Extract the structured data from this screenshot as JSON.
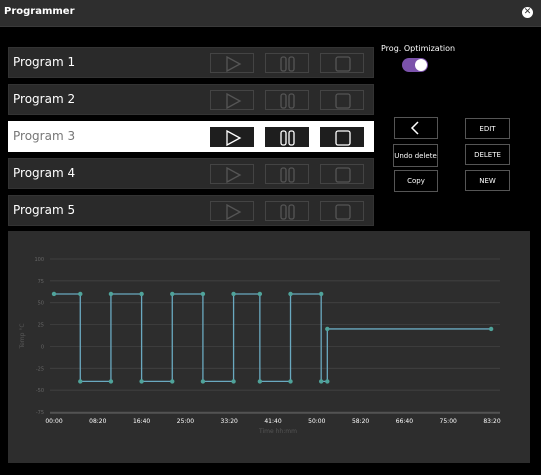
{
  "window": {
    "title": "Programmer",
    "close_icon": "close-circle-icon"
  },
  "programs": [
    {
      "label": "Program 1",
      "selected": false
    },
    {
      "label": "Program 2",
      "selected": false
    },
    {
      "label": "Program 3",
      "selected": true
    },
    {
      "label": "Program 4",
      "selected": false
    },
    {
      "label": "Program 5",
      "selected": false
    }
  ],
  "controls": {
    "play_icon": "play-icon",
    "pause_icon": "pause-icon",
    "stop_icon": "stop-icon"
  },
  "optimization": {
    "label": "Prog. Optimization",
    "enabled": true,
    "color": "#7b52ab"
  },
  "actions": {
    "back_icon": "chevron-left-icon",
    "undo_delete": "Undo delete",
    "copy": "Copy",
    "edit": "EDIT",
    "delete": "DELETE",
    "new": "NEW"
  },
  "chart_data": {
    "type": "line",
    "xlabel": "Time hh:mm",
    "ylabel": "Temp °C",
    "x_tick_labels": [
      "00:00",
      "08:20",
      "16:40",
      "25:00",
      "33:20",
      "41:40",
      "50:00",
      "58:20",
      "66:40",
      "75:00",
      "83:20"
    ],
    "y_tick_labels": [
      "100",
      "75",
      "50",
      "25",
      "0",
      "-25",
      "-50",
      "-75"
    ],
    "ylim": [
      -75,
      100
    ],
    "xlim_minutes": [
      0,
      5000
    ],
    "grid": true,
    "series_color": "#6aa9c0",
    "series": [
      {
        "name": "",
        "x_minutes": [
          0,
          300,
          300,
          650,
          650,
          1000,
          1000,
          1350,
          1350,
          1700,
          1700,
          2050,
          2050,
          2350,
          2350,
          2700,
          2700,
          3050,
          3050,
          3120,
          3120,
          4990
        ],
        "values": [
          60,
          60,
          -40,
          -40,
          60,
          60,
          -40,
          -40,
          60,
          60,
          -40,
          -40,
          60,
          60,
          -40,
          -40,
          60,
          60,
          -40,
          -40,
          20,
          20
        ]
      }
    ]
  }
}
